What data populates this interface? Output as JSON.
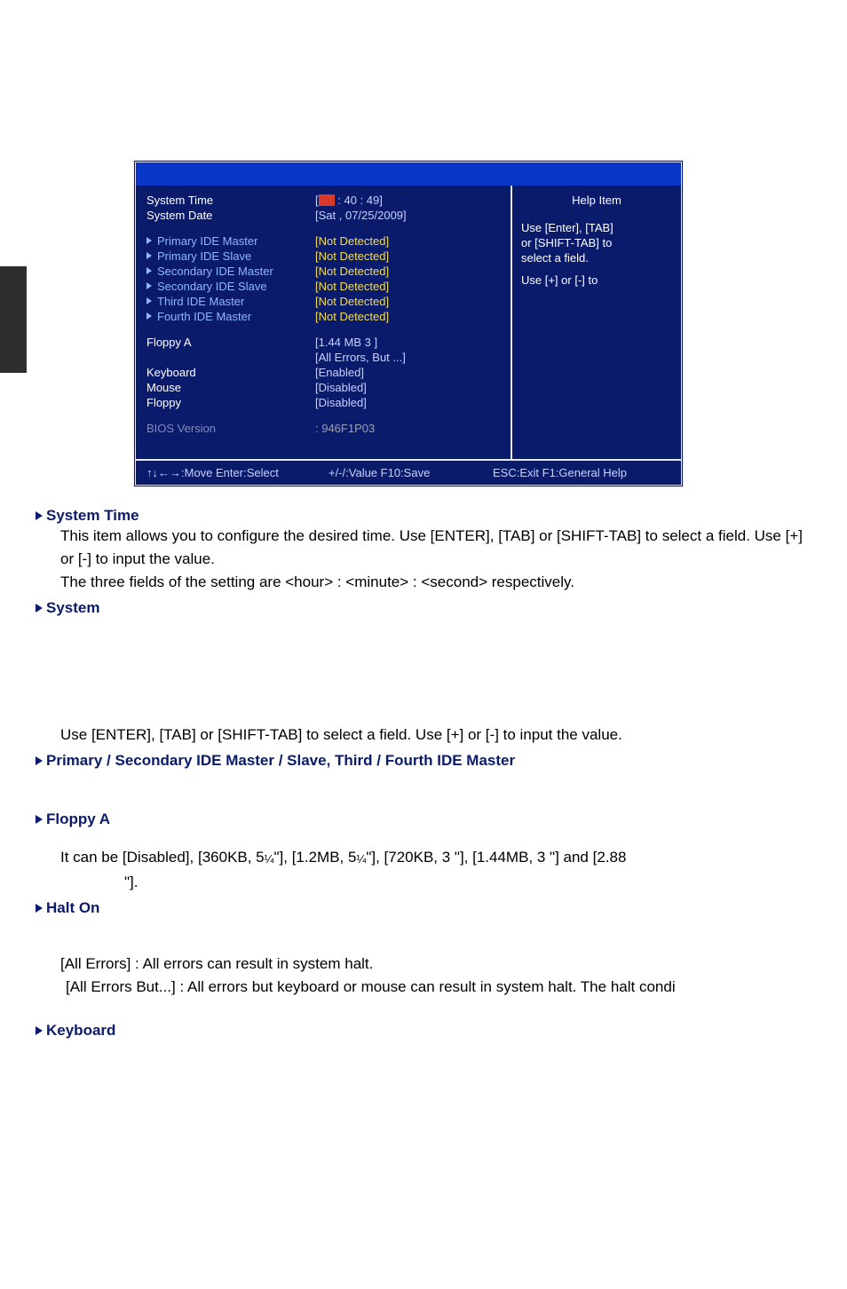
{
  "bios": {
    "rows": [
      {
        "label": "System Time",
        "value_pre": "[",
        "value_post": " : 40 : 49]",
        "cursor": true
      },
      {
        "label": "System Date",
        "value": "[Sat , 07/25/2009]"
      }
    ],
    "ide": [
      {
        "label": "Primary IDE Master",
        "value": "[Not Detected]"
      },
      {
        "label": "Primary IDE Slave",
        "value": "[Not Detected]"
      },
      {
        "label": "Secondary IDE Master",
        "value": "[Not Detected]"
      },
      {
        "label": "Secondary IDE Slave",
        "value": "[Not Detected]"
      },
      {
        "label": "Third IDE Master",
        "value": "[Not Detected]"
      },
      {
        "label": "Fourth IDE Master",
        "value": "[Not Detected]"
      }
    ],
    "misc": {
      "floppy_label": "Floppy A",
      "floppy_v1": "[1.44 MB 3   ]",
      "floppy_v2": "[All Errors, But ...]",
      "keyboard_label": "Keyboard",
      "keyboard_v": "[Enabled]",
      "mouse_label": "Mouse",
      "mouse_v": "[Disabled]",
      "floppy2_label": "Floppy",
      "floppy2_v": "[Disabled]",
      "biosver_label": "BIOS Version",
      "biosver_v": ": 946F1P03"
    },
    "help": {
      "title": "Help Item",
      "l1": "Use [Enter], [TAB]",
      "l2": "or [SHIFT-TAB] to",
      "l3": "select a field.",
      "l4": "Use [+] or [-] to"
    },
    "nav": {
      "left": "↑↓←→:Move   Enter:Select",
      "center": "+/-/:Value      F10:Save",
      "right": "ESC:Exit     F1:General Help"
    }
  },
  "doc": {
    "e1_title": "System Time",
    "e1_p1": "This item allows you to configure the desired time. Use [ENTER], [TAB] or [SHIFT-TAB] to select a field. Use [+] or [-] to input the value.",
    "e1_p2": "The three fields of the setting are <hour> : <minute> : <second> respectively.",
    "e2_title": "System",
    "e2_tail": "Use [ENTER], [TAB] or [SHIFT-TAB] to select a field. Use [+] or [-] to input the value.",
    "e3_title": "Primary / Secondary IDE Master / Slave, Third / Fourth IDE Master",
    "e4_title": "Floppy A",
    "e4_p1_a": "It can be [Disabled], [360KB, 5",
    "e4_p1_b": "\"], [1.2MB, 5",
    "e4_p1_c": "\"], [720KB, 3     \"], [1.44MB, 3     \"] and [2.88",
    "e4_p1_d": "\"].",
    "e4_frac": "¼",
    "e5_title": "Halt On",
    "e5_p1": "[All Errors] : All errors can result in system halt.",
    "e5_p2": "[All Errors But...] : All errors but keyboard or mouse can result in system halt. The halt condi",
    "e6_title": "Keyboard"
  }
}
